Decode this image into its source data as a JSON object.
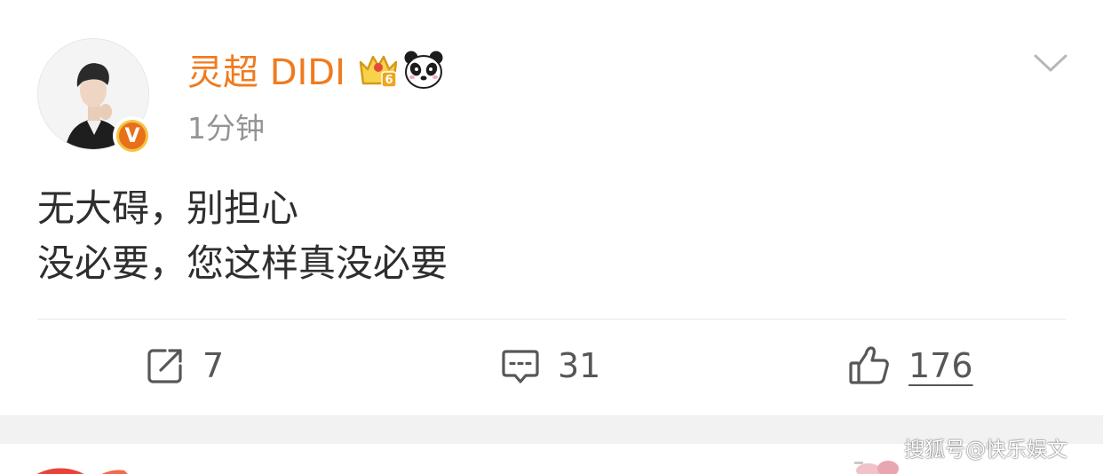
{
  "post": {
    "username": "灵超 DIDI",
    "timestamp": "1分钟",
    "content_lines": [
      "无大碍，别担心",
      "没必要，您这样真没必要"
    ],
    "badges": [
      "vip-crown-icon",
      "panda-icon"
    ],
    "verified_icon": "v-verified-icon",
    "verified_letter": "V",
    "vip_level": "6",
    "menu_icon": "chevron-down-icon"
  },
  "actions": {
    "repost": {
      "icon": "share-icon",
      "count": "7"
    },
    "comment": {
      "icon": "comment-icon",
      "count": "31"
    },
    "like": {
      "icon": "thumbs-up-icon",
      "count": "176"
    }
  },
  "watermark": "搜狐号@快乐娱文",
  "colors": {
    "username": "#f07b1f",
    "timestamp": "#949494",
    "content": "#2e2e2e",
    "icons": "#575757",
    "verified_badge": "#e8701a"
  }
}
